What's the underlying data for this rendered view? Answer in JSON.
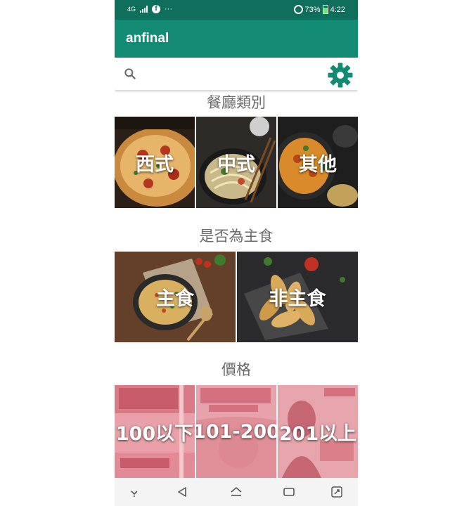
{
  "status_bar": {
    "network": "4G",
    "battery": "73%",
    "time": "4:22",
    "more": "···",
    "icons": [
      "signal-icon",
      "facebook-icon",
      "sync-icon",
      "battery-icon"
    ]
  },
  "app": {
    "title": "anfinal"
  },
  "search": {
    "placeholder": "",
    "value": ""
  },
  "sections": {
    "category": {
      "title": "餐廳類別",
      "items": [
        {
          "label": "西式"
        },
        {
          "label": "中式"
        },
        {
          "label": "其他"
        }
      ]
    },
    "staple": {
      "title": "是否為主食",
      "items": [
        {
          "label": "主食"
        },
        {
          "label": "非主食"
        }
      ]
    },
    "price": {
      "title": "價格",
      "items": [
        {
          "label": "100以下"
        },
        {
          "label": "101-200"
        },
        {
          "label": "201以上"
        }
      ]
    }
  },
  "colors": {
    "status_bar": "#0f6e5c",
    "app_bar": "#138a73",
    "accent": "#138a73",
    "section_title": "#6b6b6b"
  },
  "nav_icons": [
    "nav-down-icon",
    "nav-back-icon",
    "nav-home-icon",
    "nav-recents-icon",
    "nav-rotate-icon"
  ]
}
